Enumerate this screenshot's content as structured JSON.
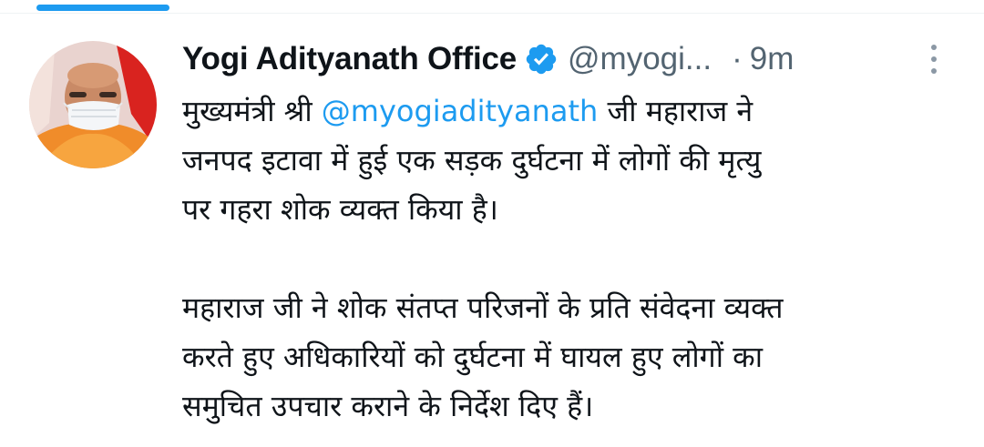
{
  "tweet": {
    "display_name": "Yogi Adityanath Office",
    "handle": "@myogi...",
    "separator": "·",
    "timestamp": "9m",
    "body": {
      "line1_before": "मुख्यमंत्री श्री ",
      "line1_mention": "@myogiadityanath",
      "line1_after": " जी महाराज ने",
      "line2": "जनपद इटावा में हुई एक सड़क दुर्घटना में लोगों की मृत्यु",
      "line3": "पर गहरा शोक व्यक्त किया है।",
      "line4": "महाराज जी ने शोक संतप्त परिजनों के प्रति संवेदना व्यक्त",
      "line5": "करते हुए अधिकारियों को दुर्घटना में घायल हुए लोगों का",
      "line6": "समुचित उपचार कराने के निर्देश दिए हैं।"
    }
  },
  "icons": {
    "verified": "verified-badge-icon",
    "more": "more-vertical-icon"
  },
  "colors": {
    "accent": "#1d9bf0",
    "text_primary": "#0f1419",
    "text_secondary": "#536471"
  }
}
